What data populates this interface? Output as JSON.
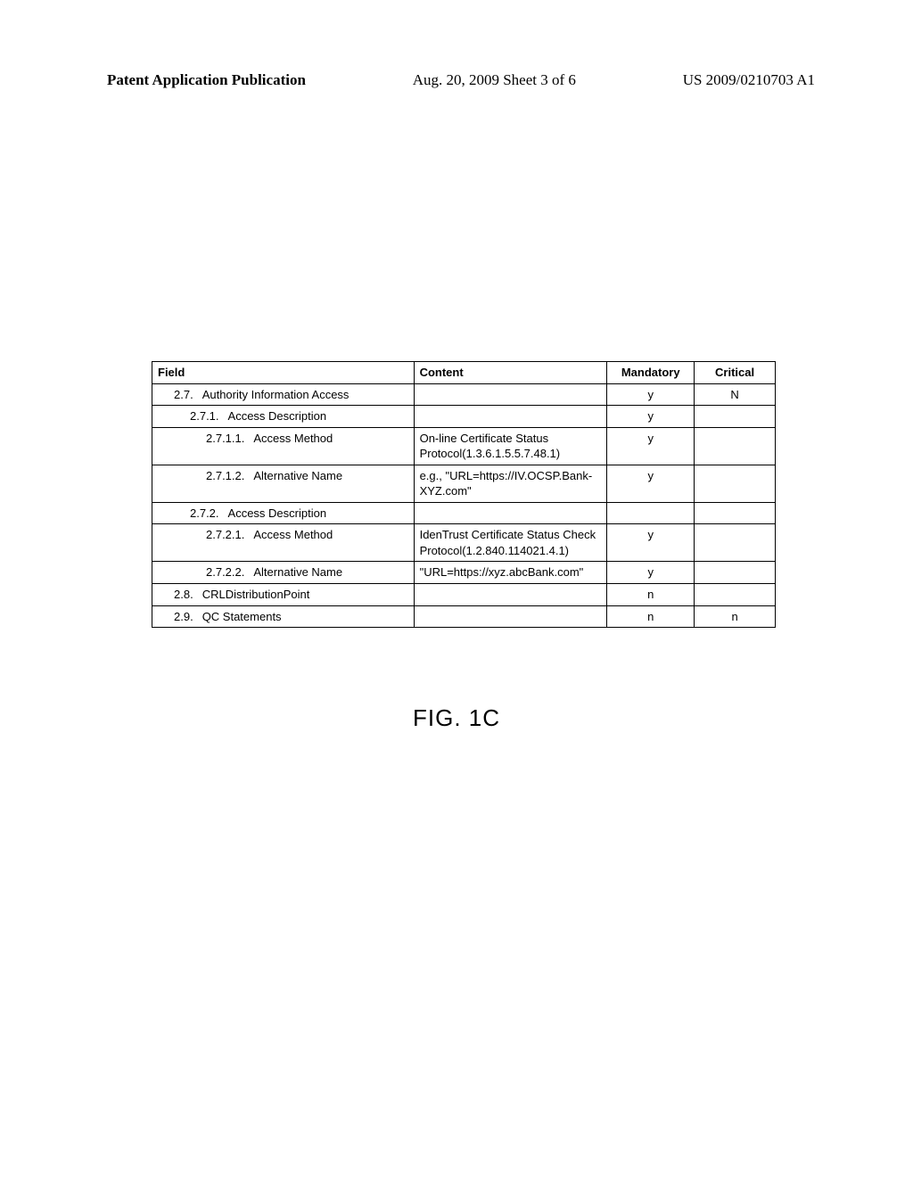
{
  "header": {
    "left": "Patent Application Publication",
    "center": "Aug. 20, 2009  Sheet 3 of 6",
    "right": "US 2009/0210703 A1"
  },
  "table": {
    "headers": {
      "field": "Field",
      "content": "Content",
      "mandatory": "Mandatory",
      "critical": "Critical"
    },
    "rows": [
      {
        "indent": 1,
        "num": "2.7.",
        "label": "Authority Information Access",
        "content": "",
        "mandatory": "y",
        "critical": "N"
      },
      {
        "indent": 2,
        "num": "2.7.1.",
        "label": "Access Description",
        "content": "",
        "mandatory": "y",
        "critical": ""
      },
      {
        "indent": 3,
        "num": "2.7.1.1.",
        "label": "Access Method",
        "content": "On-line Certificate Status Protocol(1.3.6.1.5.5.7.48.1)",
        "mandatory": "y",
        "critical": ""
      },
      {
        "indent": 3,
        "num": "2.7.1.2.",
        "label": "Alternative Name",
        "content": "e.g., \"URL=https://IV.OCSP.Bank-XYZ.com\"",
        "mandatory": "y",
        "critical": ""
      },
      {
        "indent": 2,
        "num": "2.7.2.",
        "label": "Access Description",
        "content": "",
        "mandatory": "",
        "critical": ""
      },
      {
        "indent": 3,
        "num": "2.7.2.1.",
        "label": "Access Method",
        "content": "IdenTrust Certificate Status Check Protocol(1.2.840.114021.4.1)",
        "mandatory": "y",
        "critical": ""
      },
      {
        "indent": 3,
        "num": "2.7.2.2.",
        "label": "Alternative Name",
        "content": "\"URL=https://xyz.abcBank.com\"",
        "mandatory": "y",
        "critical": ""
      },
      {
        "indent": 1,
        "num": "2.8.",
        "label": "CRLDistributionPoint",
        "content": "",
        "mandatory": "n",
        "critical": ""
      },
      {
        "indent": 1,
        "num": "2.9.",
        "label": "QC Statements",
        "content": "",
        "mandatory": "n",
        "critical": "n"
      }
    ]
  },
  "figure_caption": "FIG. 1C"
}
